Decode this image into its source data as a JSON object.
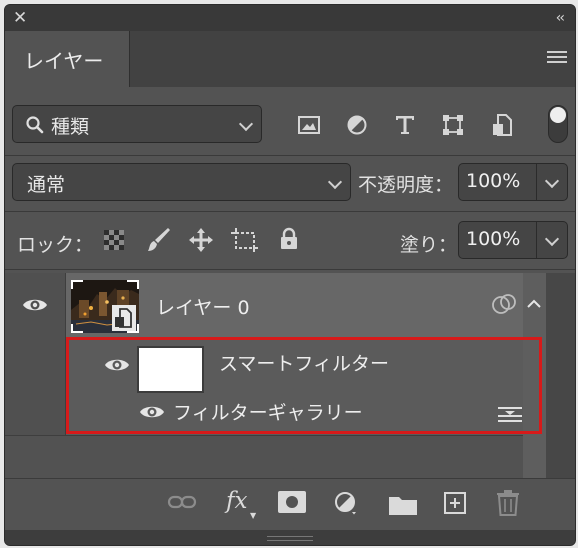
{
  "panel": {
    "tab_label": "レイヤー",
    "kind_filter": {
      "label": "種類"
    },
    "blend_mode": "通常",
    "opacity_label": "不透明度：",
    "opacity_value": "100%",
    "lock_label": "ロック：",
    "fill_label": "塗り：",
    "fill_value": "100%"
  },
  "layers": [
    {
      "name": "レイヤー 0",
      "visible": true,
      "smart_object": true,
      "expanded": true,
      "smart_filters": {
        "label": "スマートフィルター",
        "filters": [
          {
            "name": "フィルターギャラリー",
            "visible": true
          }
        ]
      }
    }
  ],
  "bottom_toolbar": {
    "fx_label": "fx"
  },
  "colors": {
    "highlight": "#d71a1a",
    "panel_bg": "#535353"
  }
}
